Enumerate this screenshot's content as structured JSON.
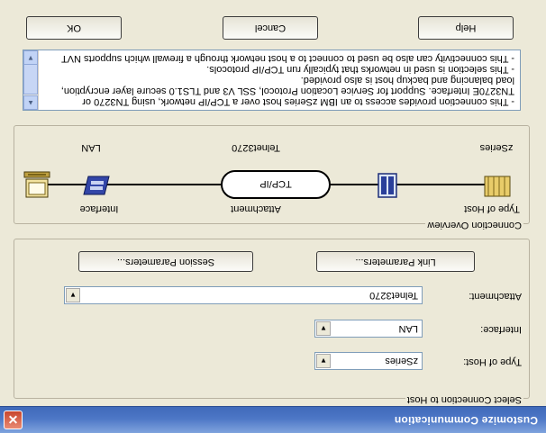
{
  "window": {
    "title": "Customize Communication",
    "close_glyph": "✕"
  },
  "select_group": {
    "legend": "Select Connection to Host",
    "type_of_host_label": "Type of Host:",
    "type_of_host_value": "zSeries",
    "interface_label": "Interface:",
    "interface_value": "LAN",
    "attachment_label": "Attachment:",
    "attachment_value": "Telnet3270",
    "link_parameters_button": "Link Parameters...",
    "session_parameters_button": "Session Parameters..."
  },
  "overview_group": {
    "legend": "Connection Overview",
    "type_of_host_label": "Type of Host",
    "attachment_label": "Attachment",
    "interface_label": "Interface",
    "host_name": "zSeries",
    "attachment_name": "Telnet3270",
    "protocol": "TCP/IP",
    "network": "LAN",
    "icons": [
      "mainframe-icon",
      "channel-icon",
      "lan-card-icon",
      "pc-icon"
    ]
  },
  "description": {
    "lines": [
      "- This connection provides access to an IBM zSeries host over a TCP/IP network, using TN3270 or",
      "TN3270E Interface. Support for Service Location Protocol, SSL V3  and TLS1.0 secure layer encryption,",
      "load balancing and backup host is also provided.",
      "- This selection is used in networks that typically run TCP/IP protocols.",
      "- This connectivity can also be used to connect to a host network through a firewall which supports NVT"
    ]
  },
  "buttons": {
    "ok": "OK",
    "cancel": "Cancel",
    "help": "Help"
  },
  "colors": {
    "title_bar": "#4d77c6",
    "dialog_bg": "#ece9d8",
    "close": "#c8472e"
  }
}
